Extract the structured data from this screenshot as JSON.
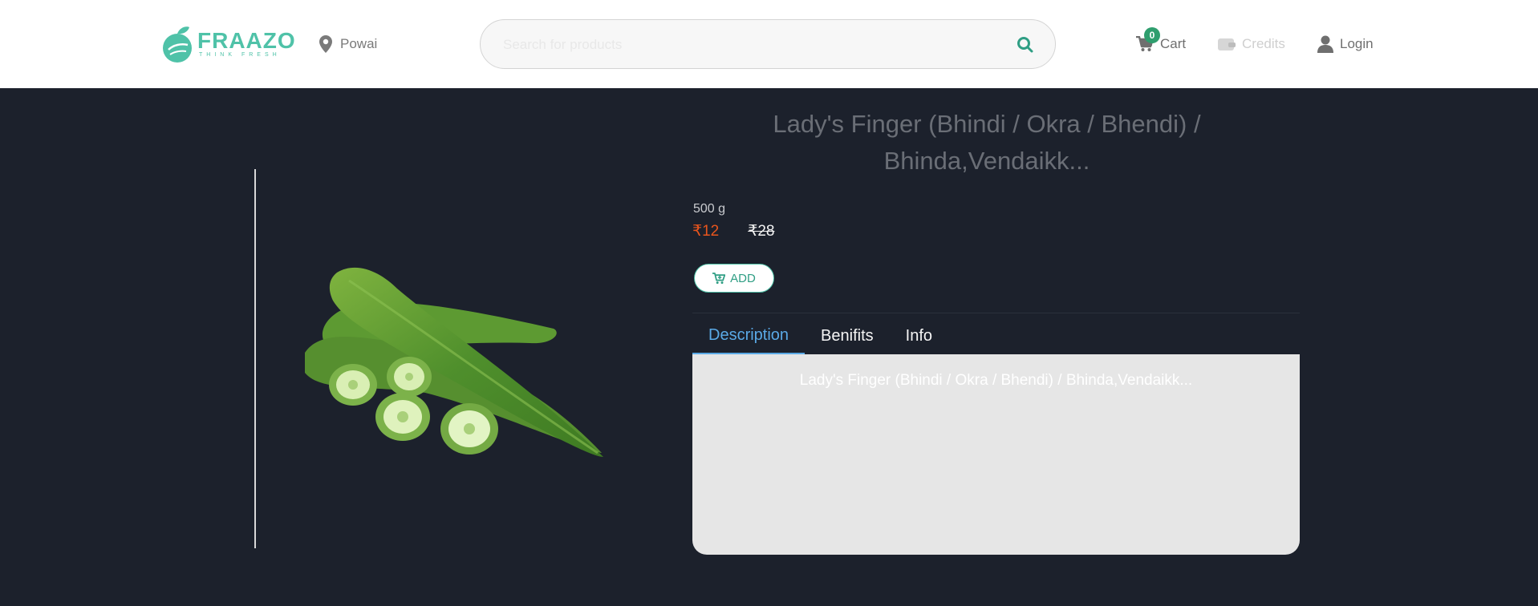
{
  "header": {
    "logo": {
      "name": "FRAAZO",
      "tagline": "THINK FRESH"
    },
    "location": {
      "label": "Powai",
      "icon": "map-pin-icon"
    },
    "search": {
      "placeholder": "Search for products",
      "value": "",
      "icon": "search-icon"
    },
    "cart": {
      "label": "Cart",
      "count": "0",
      "icon": "cart-icon"
    },
    "credits": {
      "label": "Credits",
      "icon": "wallet-icon"
    },
    "login": {
      "label": "Login",
      "icon": "user-icon"
    }
  },
  "product": {
    "title": "Lady's Finger (Bhindi / Okra / Bhendi) / Bhinda,Vendaikk...",
    "weight": "500 g",
    "price": "₹12",
    "mrp": "₹28",
    "add_label": "ADD",
    "image": "okra-image"
  },
  "tabs": [
    {
      "label": "Description",
      "active": true
    },
    {
      "label": "Benifits",
      "active": false
    },
    {
      "label": "Info",
      "active": false
    }
  ],
  "description": {
    "text": "Lady's Finger (Bhindi / Okra / Bhendi) / Bhinda,Vendaikk..."
  },
  "colors": {
    "brand": "#4fc2a8",
    "background": "#1c212c",
    "sale_price": "#e8551d",
    "active_tab": "#5aa9e6",
    "badge": "#2f9e6e"
  }
}
